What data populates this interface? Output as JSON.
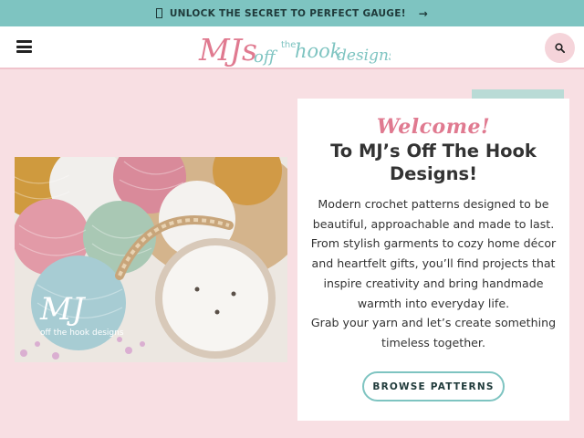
{
  "promo": {
    "icon": "image-placeholder-icon",
    "text": "UNLOCK THE SECRET TO PERFECT GAUGE!",
    "arrow": "→"
  },
  "header": {
    "logo": {
      "script": "MJs",
      "off": "off",
      "the": "the",
      "hook": "hook",
      "designs": "designs"
    }
  },
  "hero_image": {
    "watermark": {
      "mj": "MJ",
      "sub": "off the hook designs"
    }
  },
  "welcome": {
    "script": "Welcome!",
    "title": "To MJ’s Off The Hook Designs!",
    "body": "Modern crochet patterns designed to be beautiful, approachable and made to last. From stylish garments to cozy home décor and heartfelt gifts, you’ll find projects that inspire creativity and bring handmade warmth into everyday life.",
    "body2": "Grab your yarn and let’s create something timeless together.",
    "button": "BROWSE PATTERNS"
  },
  "colors": {
    "accent_teal": "#7ec4c1",
    "accent_pink": "#e07a90",
    "page_bg": "#f8dfe3"
  }
}
